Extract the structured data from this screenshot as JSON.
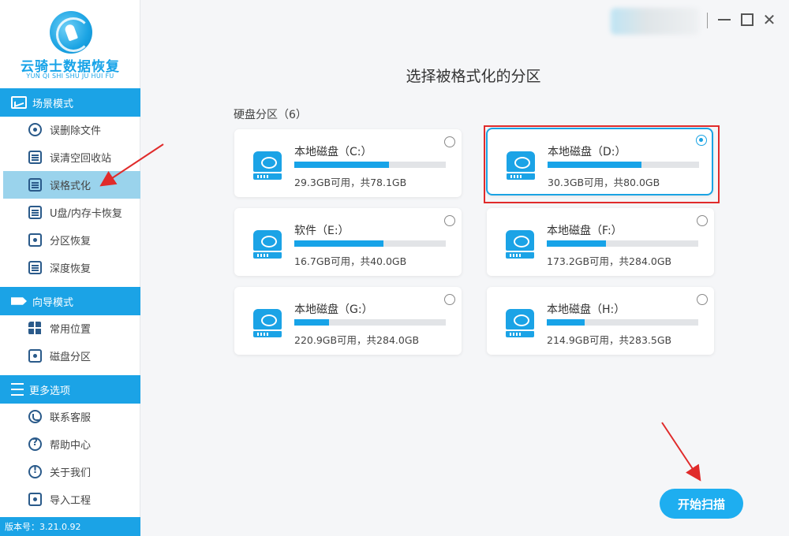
{
  "app": {
    "title": "云骑士数据恢复",
    "subtitle": "YUN QI SHI SHU JU HUI FU",
    "version": "版本号：3.21.0.92"
  },
  "sidebar": {
    "sections": [
      {
        "title": "场景模式",
        "icon": "scene-icon",
        "items": [
          {
            "label": "误删除文件",
            "icon": "deleted-file-icon"
          },
          {
            "label": "误清空回收站",
            "icon": "recycle-bin-icon"
          },
          {
            "label": "误格式化",
            "icon": "format-icon",
            "active": true
          },
          {
            "label": "U盘/内存卡恢复",
            "icon": "sd-card-icon"
          },
          {
            "label": "分区恢复",
            "icon": "partition-icon"
          },
          {
            "label": "深度恢复",
            "icon": "deep-recovery-icon"
          }
        ]
      },
      {
        "title": "向导模式",
        "icon": "signpost-icon",
        "items": [
          {
            "label": "常用位置",
            "icon": "windows-icon"
          },
          {
            "label": "磁盘分区",
            "icon": "disk-icon"
          }
        ]
      },
      {
        "title": "更多选项",
        "icon": "menu-icon",
        "items": [
          {
            "label": "联系客服",
            "icon": "phone-icon"
          },
          {
            "label": "帮助中心",
            "icon": "help-icon"
          },
          {
            "label": "关于我们",
            "icon": "info-icon"
          },
          {
            "label": "导入工程",
            "icon": "import-icon"
          }
        ]
      }
    ]
  },
  "main": {
    "title": "选择被格式化的分区",
    "disk_heading": "硬盘分区（6）",
    "partitions": [
      {
        "name": "本地磁盘（C:）",
        "info": "29.3GB可用，共78.1GB",
        "used_fraction": 0.625,
        "selected": false
      },
      {
        "name": "本地磁盘（D:）",
        "info": "30.3GB可用，共80.0GB",
        "used_fraction": 0.62,
        "selected": true
      },
      {
        "name": "软件（E:）",
        "info": "16.7GB可用，共40.0GB",
        "used_fraction": 0.59,
        "selected": false
      },
      {
        "name": "本地磁盘（F:）",
        "info": "173.2GB可用，共284.0GB",
        "used_fraction": 0.39,
        "selected": false
      },
      {
        "name": "本地磁盘（G:）",
        "info": "220.9GB可用，共284.0GB",
        "used_fraction": 0.23,
        "selected": false
      },
      {
        "name": "本地磁盘（H:）",
        "info": "214.9GB可用，共283.5GB",
        "used_fraction": 0.25,
        "selected": false
      }
    ],
    "start_button": "开始扫描"
  },
  "colors": {
    "accent": "#1ba3e6",
    "highlight": "#e02b2b",
    "active_nav": "#9ad3ec"
  }
}
